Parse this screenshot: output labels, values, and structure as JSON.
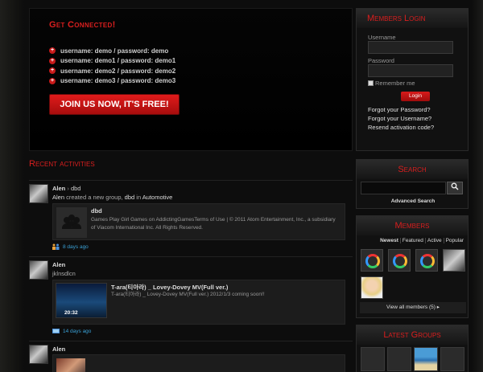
{
  "connect": {
    "title": "Get Connected!",
    "demos": [
      "username: demo / password: demo",
      "username: demo1 / password: demo1",
      "username: demo2 / password: demo2",
      "username: demo3 / password: demo3"
    ],
    "join_label": "JOIN US NOW, IT'S FREE!"
  },
  "login": {
    "title": "Members Login",
    "username_label": "Username",
    "password_label": "Password",
    "remember_label": "Remember me",
    "button_label": "Login",
    "links": [
      "Forgot your Password?",
      "Forgot your Username?",
      "Resend activation code?"
    ]
  },
  "activities": {
    "title": "Recent activities",
    "items": [
      {
        "user": "Alen",
        "target": "dbd",
        "action_prefix": "created a new group,",
        "group": "dbd",
        "in_word": "in",
        "category": "Automotive",
        "card_title": "dbd",
        "card_desc": "Games Play Girl Games on AddictingGamesTerms of Use | © 2011 Atom Entertainment, Inc., a subsidiary of Viacom International Inc. All Rights Reserved.",
        "time": "8 days ago"
      },
      {
        "user": "Alen",
        "text": "jklnsdlcn",
        "card_title": "T-ara(티아라) _ Lovey-Dovey MV(Full ver.)",
        "card_desc": "T-ara(티아라) _ Lovey-Dovey MV(Full ver.) 2012/1/3 coming soon!!",
        "duration": "20:32",
        "time": "14 days ago"
      },
      {
        "user": "Alen"
      }
    ]
  },
  "search": {
    "title": "Search",
    "advanced_label": "Advanced Search",
    "button_icon": "search-icon"
  },
  "members": {
    "title": "Members",
    "tabs": [
      "Newest",
      "Featured",
      "Active",
      "Popular"
    ],
    "view_all": "View all members (5) ▸"
  },
  "groups": {
    "title": "Latest Groups"
  },
  "colors": {
    "accent_red": "#d91e1e",
    "link_blue": "#3aa0d5",
    "background": "#0d0d0d"
  }
}
